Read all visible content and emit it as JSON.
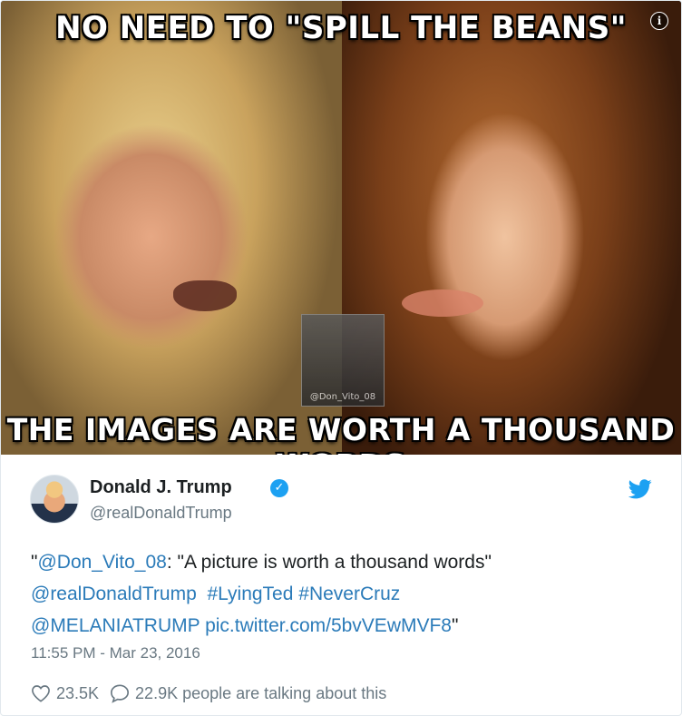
{
  "media": {
    "top_caption": "NO NEED TO \"SPILL THE BEANS\"",
    "bottom_caption": "THE IMAGES ARE WORTH A THOUSAND WORDS",
    "watermark": "@Don_Vito_08"
  },
  "author": {
    "name": "Donald J. Trump",
    "handle": "@realDonaldTrump"
  },
  "tweet": {
    "q_open": "\"",
    "mention1": "@Don_Vito_08",
    "quote": ": \"A picture is worth a thousand words\"",
    "mention2": "@realDonaldTrump",
    "hashtag1": "#LyingTed",
    "hashtag2": "#NeverCruz",
    "mention3": "@MELANIATRUMP",
    "pic_link": "pic.twitter.com/5bvVEwMVF8",
    "q_close": "\""
  },
  "timestamp": "11:55 PM - Mar 23, 2016",
  "stats": {
    "likes": "23.5K",
    "talking": "22.9K people are talking about this"
  },
  "colors": {
    "link": "#2b7bb9",
    "muted": "#697882",
    "verified": "#1da1f2"
  }
}
